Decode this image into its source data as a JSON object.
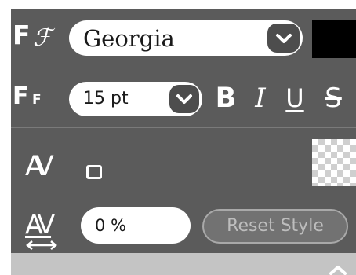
{
  "font_row": {
    "icon_big": "F",
    "icon_script": "ℱ",
    "family_value": "Georgia",
    "dropdown_icon": "chevron-down-icon",
    "text_color": "#000000"
  },
  "size_row": {
    "icon_big": "F",
    "icon_small": "F",
    "size_value": "15 pt",
    "bold_label": "B",
    "italic_label": "I",
    "underline_label": "U",
    "strike_label": "S"
  },
  "kerning_row": {
    "icon_label": "AV",
    "enabled": false,
    "background_color": "transparent"
  },
  "spacing_row": {
    "icon_label": "AV",
    "value": "0 %",
    "reset_label": "Reset Style"
  },
  "colors": {
    "panel_bg": "#5b5b5b",
    "field_bg": "#ffffff",
    "bottom_bar": "#c4c4c4"
  }
}
